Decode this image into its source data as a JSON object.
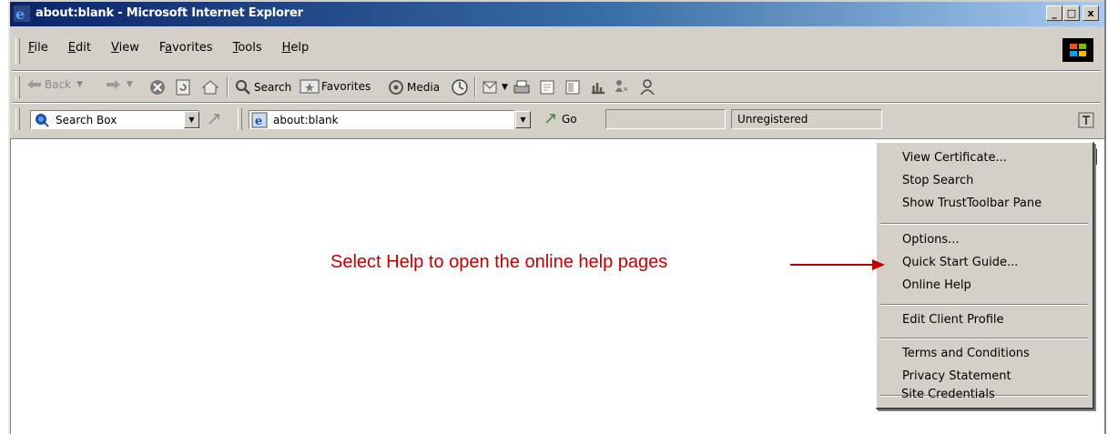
{
  "window": {
    "title": "about:blank - Microsoft Internet Explorer",
    "buttons": {
      "minimize": "_",
      "maximize": "□",
      "close": "x"
    }
  },
  "menubar": {
    "items": [
      {
        "label": "File",
        "accel": "F",
        "rest": "ile"
      },
      {
        "label": "Edit",
        "accel": "E",
        "rest": "dit"
      },
      {
        "label": "View",
        "accel": "V",
        "rest": "iew"
      },
      {
        "label": "Favorites",
        "pre": "F",
        "accel": "a",
        "rest": "vorites"
      },
      {
        "label": "Tools",
        "accel": "T",
        "rest": "ools"
      },
      {
        "label": "Help",
        "accel": "H",
        "rest": "elp"
      }
    ]
  },
  "toolbar": {
    "back": "Back",
    "search": "Search",
    "favorites": "Favorites",
    "media": "Media"
  },
  "addressbar": {
    "searchbox": "Search Box",
    "address": "about:blank",
    "go": "Go",
    "status": "Unregistered"
  },
  "popup_menu": {
    "items": [
      "View Certificate...",
      "Stop Search",
      "Show TrustToolbar Pane",
      "Options...",
      "Quick Start Guide...",
      "Online Help",
      "Edit Client Profile",
      "Terms and Conditions",
      "Privacy Statement",
      "Site Credentials"
    ]
  },
  "annotation": {
    "text": "Select Help to open the online help pages",
    "color": "#c00000"
  },
  "colors": {
    "titlebar_start": "#0a246a",
    "titlebar_end": "#a6caf0",
    "chrome": "#d4d0c8"
  }
}
